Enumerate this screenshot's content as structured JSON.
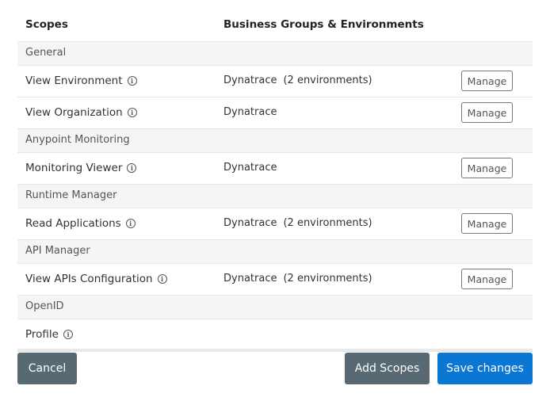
{
  "header": {
    "scopes_label": "Scopes",
    "bg_label": "Business Groups & Environments"
  },
  "groups": [
    {
      "name": "General",
      "scopes": [
        {
          "name": "View Environment",
          "business_group": "Dynatrace",
          "environments": "(2 environments)",
          "action": "Manage"
        },
        {
          "name": "View Organization",
          "business_group": "Dynatrace",
          "environments": "",
          "action": "Manage"
        }
      ]
    },
    {
      "name": "Anypoint Monitoring",
      "scopes": [
        {
          "name": "Monitoring Viewer",
          "business_group": "Dynatrace",
          "environments": "",
          "action": "Manage"
        }
      ]
    },
    {
      "name": "Runtime Manager",
      "scopes": [
        {
          "name": "Read Applications",
          "business_group": "Dynatrace",
          "environments": "(2 environments)",
          "action": "Manage"
        }
      ]
    },
    {
      "name": "API Manager",
      "scopes": [
        {
          "name": "View APIs Configuration",
          "business_group": "Dynatrace",
          "environments": "(2 environments)",
          "action": "Manage"
        }
      ]
    },
    {
      "name": "OpenID",
      "scopes": [
        {
          "name": "Profile",
          "business_group": "",
          "environments": "",
          "action": ""
        }
      ]
    }
  ],
  "info_glyph": "i",
  "footer": {
    "cancel_label": "Cancel",
    "add_scopes_label": "Add Scopes",
    "save_label": "Save changes"
  },
  "colors": {
    "secondary_button": "#596973",
    "primary_button": "#0a77d5",
    "group_row_bg": "#f5f5f5"
  }
}
